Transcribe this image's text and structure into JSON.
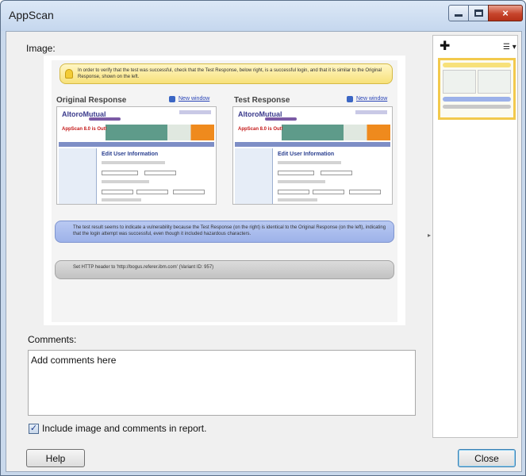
{
  "window": {
    "title": "AppScan",
    "controls": {
      "minimize": "minimize",
      "maximize": "maximize",
      "close": "×"
    }
  },
  "image_section": {
    "label": "Image:",
    "note_top": "In order to verify that the test was successful, check that the Test Response, below right, is a successful login, and that it is similar to the Original Response, shown on the left.",
    "original": {
      "title": "Original Response",
      "new_window": "New window"
    },
    "test": {
      "title": "Test Response",
      "new_window": "New window"
    },
    "app_logo": "AltoroMutual",
    "banner_text": "AppScan 8.0 is Out!",
    "page_heading": "Edit User Information",
    "note_result": "The test result seems to indicate a vulnerability because the Test Response (on the right) is identical to the Original Response (on the left), indicating that the login attempt was successful, even though it included hazardous characters.",
    "note_variant": "Set HTTP header to 'http://bogus.referer.ibm.com' (Variant ID: 957)"
  },
  "comments": {
    "label": "Comments:",
    "value": "Add comments here"
  },
  "include": {
    "checked": true,
    "label": "Include image and comments in report."
  },
  "buttons": {
    "help": "Help",
    "close": "Close"
  },
  "thumbnails": {
    "add_icon": "plus-icon",
    "view_icon": "list-view-icon",
    "add_glyph": "✚",
    "view_glyph": "☰ ▾",
    "divider_glyph": "▸",
    "check_glyph": "✓"
  }
}
